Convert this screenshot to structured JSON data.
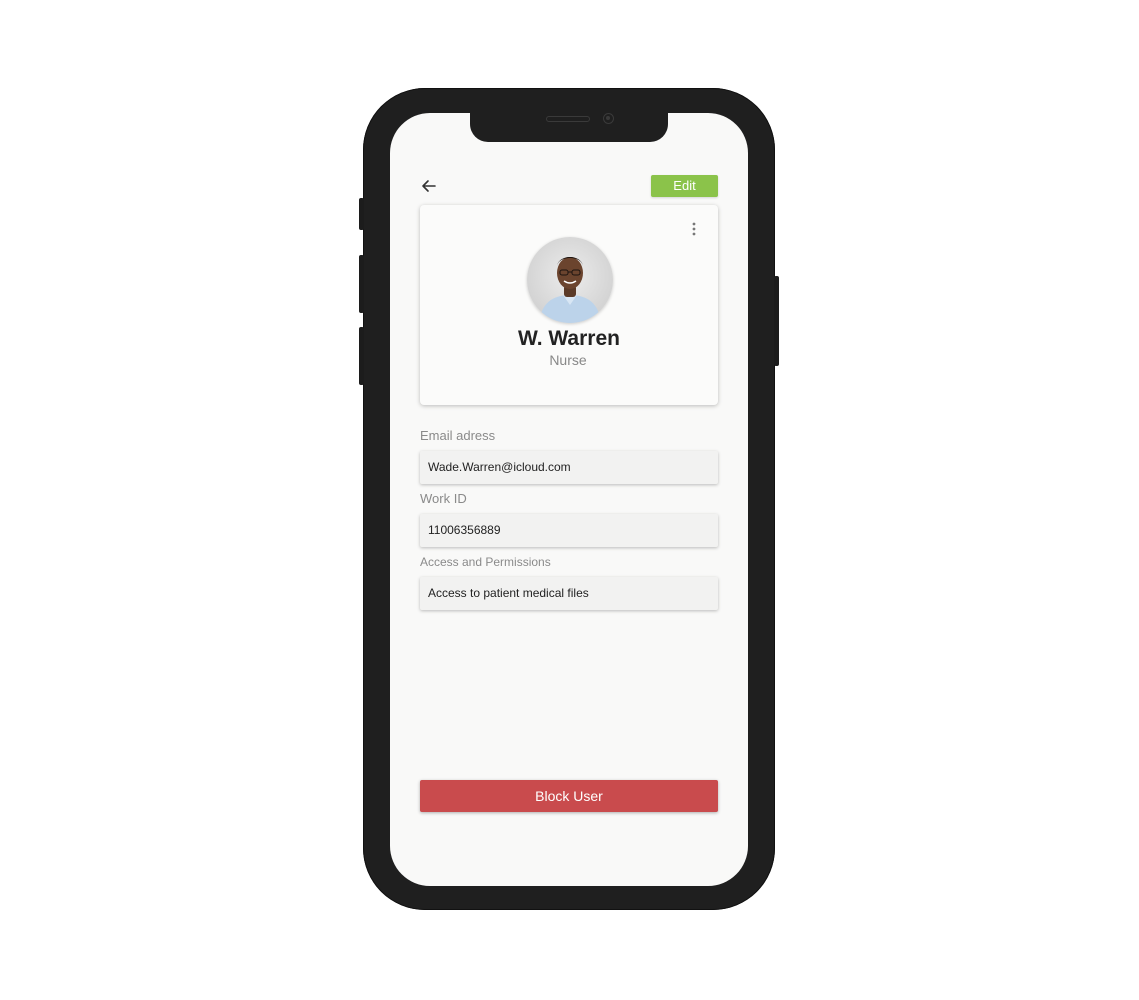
{
  "header": {
    "back_icon": "arrow-left-icon",
    "edit_label": "Edit",
    "edit_color": "#8bc34a"
  },
  "profile": {
    "name": "W. Warren",
    "role": "Nurse",
    "more_icon": "more-vertical-icon"
  },
  "fields": {
    "email_label": "Email adress",
    "email_value": "Wade.Warren@icloud.com",
    "work_id_label": "Work ID",
    "work_id_value": "11006356889",
    "access_label": "Access and Permissions",
    "access_value": "Access to patient medical files"
  },
  "actions": {
    "block_label": "Block User",
    "block_color": "#c94b4d"
  }
}
